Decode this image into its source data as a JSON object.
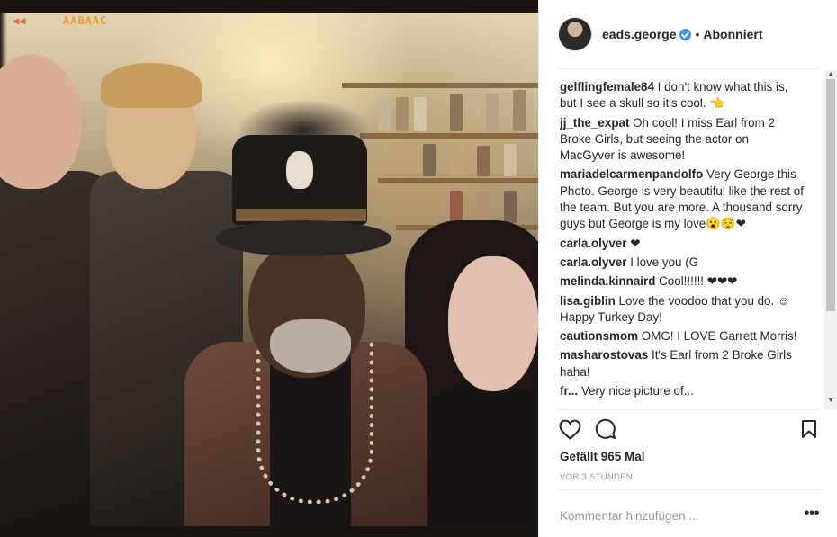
{
  "photo": {
    "film_code": "AABAAC",
    "film_arrow": "◀◀"
  },
  "post": {
    "username": "eads.george",
    "separator": "•",
    "follow_state": "Abonniert"
  },
  "comments": [
    {
      "user": "gelflingfemale84",
      "text": "I don't know what this is, but I see a skull so it's cool. 👈"
    },
    {
      "user": "jj_the_expat",
      "text": "Oh cool! I miss Earl from 2 Broke Girls, but seeing the actor on MacGyver is awesome!"
    },
    {
      "user": "mariadelcarmenpandolfo",
      "text": "Very George this Photo. George is very beautiful like the rest of the team. But you are more. A thousand sorry guys but George is my love😮😌❤"
    },
    {
      "user": "carla.olyver",
      "text": "❤"
    },
    {
      "user": "carla.olyver",
      "text": "I love you (G"
    },
    {
      "user": "melinda.kinnaird",
      "text": "Cool!!!!!! ❤❤❤"
    },
    {
      "user": "lisa.giblin",
      "text": "Love the voodoo that you do. ☺ Happy Turkey Day!"
    },
    {
      "user": "cautionsmom",
      "text": "OMG! I LOVE Garrett Morris!"
    },
    {
      "user": "masharostovas",
      "text": "It's Earl from 2 Broke Girls haha!"
    },
    {
      "user": "fr...",
      "text": "Very nice picture of..."
    }
  ],
  "likes": "Gefällt 965 Mal",
  "timestamp": "VOR 3 STUNDEN",
  "comment_input": {
    "placeholder": "Kommentar hinzufügen ..."
  },
  "more_label": "•••",
  "icons": {
    "like": "heart-outline-icon",
    "comment": "speech-bubble-icon",
    "save": "bookmark-icon",
    "verified": "verified-badge-icon"
  },
  "colors": {
    "verified": "#3897f0",
    "text": "#262626",
    "muted": "#999999",
    "divider": "#efefef"
  }
}
